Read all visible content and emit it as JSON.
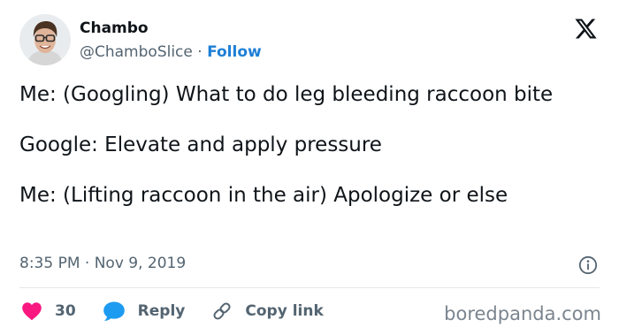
{
  "author": {
    "display_name": "Chambo",
    "handle": "@ChamboSlice",
    "separator": "·",
    "follow_label": "Follow"
  },
  "tweet": {
    "lines": [
      "Me: (Googling) What to do leg bleeding raccoon bite",
      "Google: Elevate and apply pressure",
      "Me: (Lifting raccoon in the air) Apologize or else"
    ]
  },
  "meta": {
    "time": "8:35 PM",
    "separator": "·",
    "date": "Nov 9, 2019"
  },
  "actions": {
    "like_count": "30",
    "reply_label": "Reply",
    "copy_link_label": "Copy link"
  },
  "watermark": "boredpanda.com",
  "colors": {
    "text": "#0f1419",
    "secondary": "#536471",
    "follow": "#1d7fd6",
    "like": "#f91880",
    "reply": "#1d9bf0",
    "divider": "#e3e8eb"
  },
  "icons": [
    "x-logo-icon",
    "info-icon",
    "heart-icon",
    "reply-bubble-icon",
    "link-icon"
  ]
}
